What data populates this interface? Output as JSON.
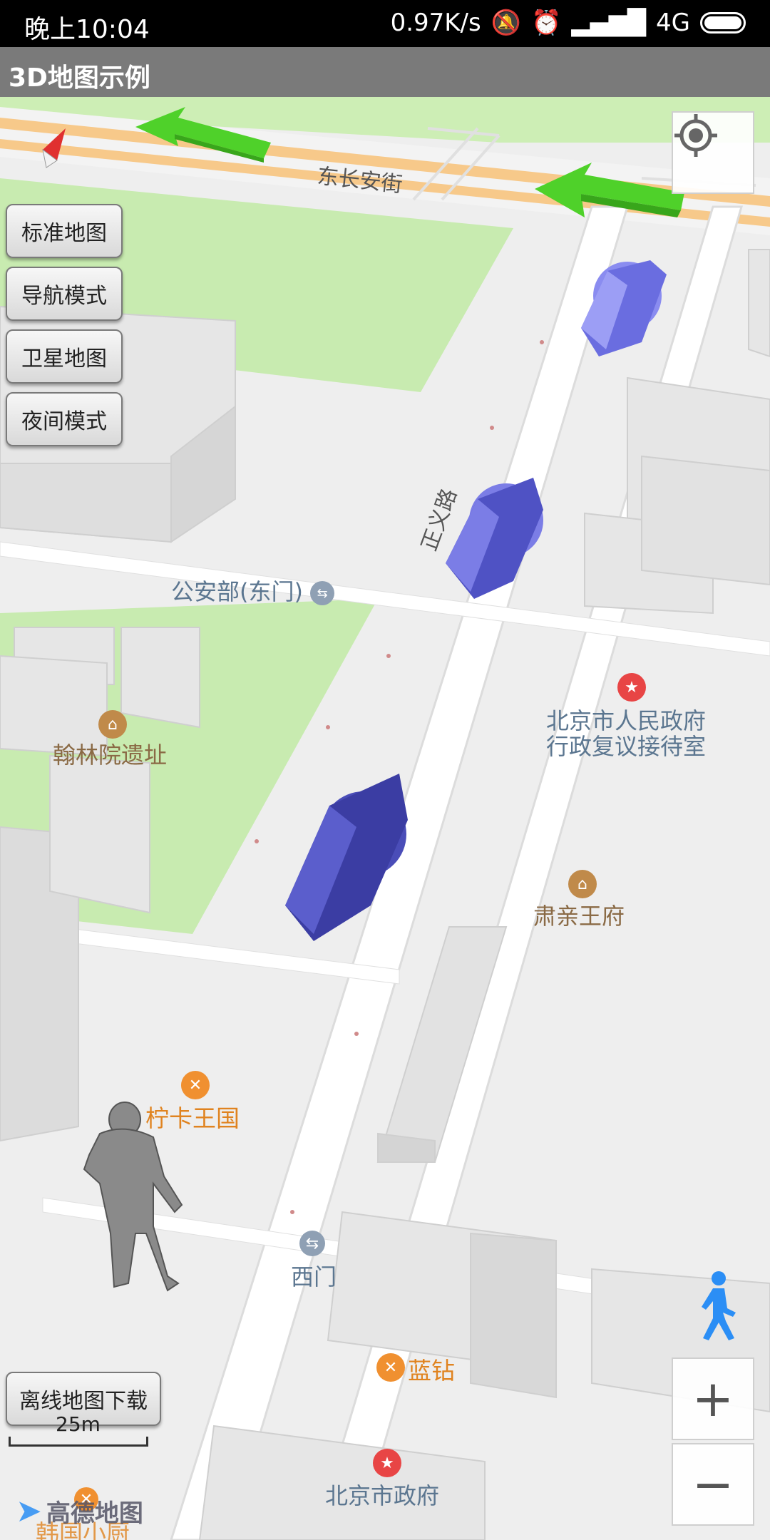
{
  "status_bar": {
    "time": "晚上10:04",
    "net_speed": "0.97K/s",
    "network": "4G"
  },
  "title_bar": {
    "title": "3D地图示例"
  },
  "map_type_buttons": [
    "标准地图",
    "导航模式",
    "卫星地图",
    "夜间模式"
  ],
  "offline_button": "离线地图下载",
  "scale": {
    "label": "25m"
  },
  "logo": {
    "text": "高德地图"
  },
  "roads": {
    "dongchangan": "东长安街",
    "zhengyi": "正义路"
  },
  "pois": {
    "gonganbu": "公安部(东门)",
    "hanlinyuan": "翰林院遗址",
    "renmin_line1": "北京市人民政府",
    "renmin_line2": "行政复议接待室",
    "suqinwang": "肃亲王府",
    "ningka": "柠卡王国",
    "ximen": "西门",
    "lanzuan": "蓝钻",
    "zhengfu": "北京市政府",
    "xiaochu": "韩国小厨"
  },
  "colors": {
    "green_area": "#c8ebb0",
    "road_orange": "#f7c98a",
    "arrow_blue": "#5a5ec9",
    "arrow_green": "#4fd12a",
    "poi_red": "#e84545",
    "poi_orange": "#f09030",
    "poi_brown": "#c08a4a",
    "poi_gray": "#8fa0b4",
    "pedestrian_blue": "#2b8ef5"
  }
}
